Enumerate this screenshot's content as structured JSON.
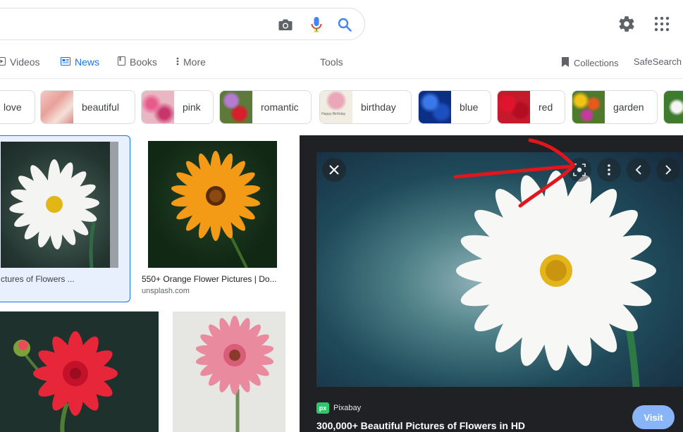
{
  "search": {
    "camera_icon": "camera-icon",
    "mic_icon": "mic-icon",
    "search_icon": "search-icon"
  },
  "header": {
    "settings_icon": "gear-icon",
    "apps_icon": "apps-grid-icon"
  },
  "tabs": [
    {
      "label": "Videos",
      "icon": "video-icon",
      "active": false
    },
    {
      "label": "News",
      "icon": "news-icon",
      "active": true
    },
    {
      "label": "Books",
      "icon": "book-icon",
      "active": false
    },
    {
      "label": "More",
      "icon": "more-vert-icon",
      "active": false
    }
  ],
  "tools_label": "Tools",
  "collections_label": "Collections",
  "safesearch_label": "SafeSearch",
  "chips": [
    {
      "label": "love"
    },
    {
      "label": "beautiful"
    },
    {
      "label": "pink"
    },
    {
      "label": "romantic"
    },
    {
      "label": "birthday",
      "thumb_text": "Happy Birthday"
    },
    {
      "label": "blue"
    },
    {
      "label": "red"
    },
    {
      "label": "garden"
    }
  ],
  "results": [
    {
      "caption": "ctures of Flowers ..."
    },
    {
      "caption": "550+ Orange Flower Pictures | Do...",
      "source": "unsplash.com"
    }
  ],
  "preview": {
    "source": "Pixabay",
    "source_logo": "px",
    "title": "300,000+ Beautiful Pictures of Flowers in HD",
    "visit_label": "Visit"
  },
  "colors": {
    "accent": "#1a73e8",
    "panel_bg": "#202124",
    "visit": "#8ab4f8",
    "annotation": "#e0161c"
  }
}
